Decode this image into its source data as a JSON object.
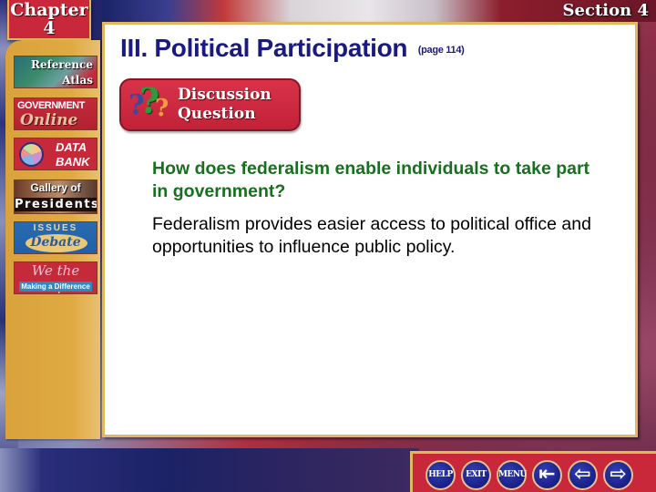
{
  "header": {
    "chapter_label": "Chapter",
    "chapter_number": "4",
    "section_label": "Section 4"
  },
  "sidebar": {
    "items": [
      {
        "id": "reference-atlas",
        "line1": "Reference",
        "line2": "Atlas"
      },
      {
        "id": "government-online",
        "line1": "GOVERNMENT",
        "line2": "Online"
      },
      {
        "id": "data-bank",
        "line1": "DATA",
        "line2": "BANK"
      },
      {
        "id": "gallery-of-presidents",
        "line1": "Gallery of",
        "line2": "Presidents"
      },
      {
        "id": "issues-to-debate",
        "line1": "ISSUES",
        "line2": "Debate"
      },
      {
        "id": "we-the-people",
        "line1": "We the People",
        "line2": "Making a Difference"
      }
    ]
  },
  "main": {
    "title": "III. Political Participation",
    "page_ref": "(page 114)",
    "badge": {
      "line1": "Discussion",
      "line2": "Question",
      "icon_glyphs": [
        "?",
        "?",
        "?"
      ]
    },
    "question": "How does federalism enable individuals to take part in government?",
    "answer": "Federalism provides easier access to political office and opportunities to influence public policy."
  },
  "navbar": {
    "help_label": "HELP",
    "exit_label": "EXIT",
    "menu_label": "MENU",
    "first_glyph": "⇤",
    "prev_glyph": "⇦",
    "next_glyph": "⇨"
  },
  "colors": {
    "title": "#1a1a80",
    "question": "#17701e",
    "answer": "#000000",
    "accent_red": "#c8283a",
    "gold_border": "#e3b660",
    "nav_button_blue": "#1a1e88"
  }
}
